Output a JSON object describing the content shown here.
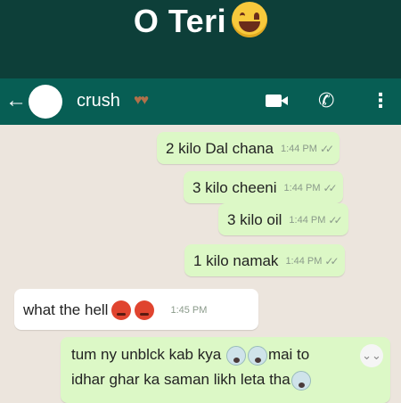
{
  "meme": {
    "title": "O Teri"
  },
  "header": {
    "back_icon": "arrow-left-icon",
    "contact_name": "crush",
    "hearts": "♥♥",
    "video_icon": "video-call-icon",
    "call_icon": "phone-icon",
    "menu_icon": "more-vertical-icon"
  },
  "messages": [
    {
      "direction": "outgoing",
      "text": "2 kilo Dal chana",
      "time": "1:44 PM",
      "ticks": "✓✓"
    },
    {
      "direction": "outgoing",
      "text": "3 kilo cheeni",
      "time": "1:44 PM",
      "ticks": "✓✓"
    },
    {
      "direction": "outgoing",
      "text": "3 kilo oil",
      "time": "1:44 PM",
      "ticks": "✓✓"
    },
    {
      "direction": "outgoing",
      "text": "1 kilo namak",
      "time": "1:44 PM",
      "ticks": "✓✓"
    },
    {
      "direction": "incoming",
      "text": "what the hell",
      "time": "1:45 PM"
    },
    {
      "direction": "outgoing",
      "line1_a": "tum ny unblck kab kya",
      "line1_b": "mai to",
      "line2": "idhar ghar ka saman likh leta tha"
    }
  ],
  "scroll_button": {
    "glyph": "⌄⌄"
  },
  "colors": {
    "appbar": "#075e54",
    "outgoing_bubble": "#dcf8c6",
    "chat_bg": "#ece5dd"
  }
}
